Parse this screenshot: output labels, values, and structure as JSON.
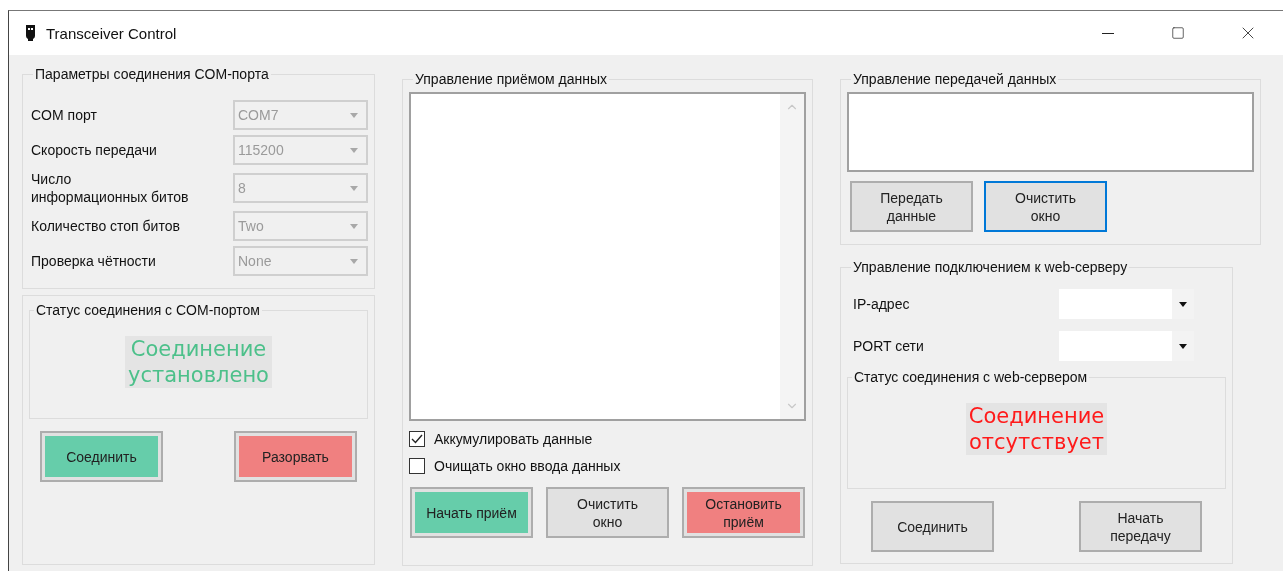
{
  "window": {
    "title": "Transceiver Control"
  },
  "com_params": {
    "title": "Параметры соединения COM-порта",
    "fields": [
      {
        "label": "COM порт",
        "value": "COM7",
        "disabled": true
      },
      {
        "label": "Скорость передачи",
        "value": "115200",
        "disabled": true
      },
      {
        "label": "Число\nинформационных битов",
        "value": "8",
        "disabled": true
      },
      {
        "label": "Количество стоп битов",
        "value": "Two",
        "disabled": true
      },
      {
        "label": "Проверка чётности",
        "value": "None",
        "disabled": true
      }
    ]
  },
  "com_status": {
    "title": "Статус соединения с COM-портом",
    "status": {
      "text": "Соединение\nустановлено",
      "color": "#4cc08a"
    },
    "buttons": [
      {
        "label": "Соединить",
        "color": "#66cdaa",
        "focused": false
      },
      {
        "label": "Разорвать",
        "color": "#f08080",
        "focused": false
      }
    ]
  },
  "receive": {
    "title": "Управление приёмом данных",
    "options": [
      {
        "label": "Аккумулировать данные",
        "checked": true
      },
      {
        "label": "Очищать окно ввода данных",
        "checked": false
      }
    ],
    "buttons": [
      {
        "label": "Начать приём",
        "color": "#66cdaa",
        "focused": false
      },
      {
        "label": "Очистить\nокно",
        "color": "#e1e1e1",
        "focused": false
      },
      {
        "label": "Остановить\nприём",
        "color": "#f08080",
        "focused": false
      }
    ]
  },
  "transmit": {
    "title": "Управление передачей данных",
    "buttons": [
      {
        "label": "Передать\nданные",
        "color": "#e1e1e1",
        "focused": false
      },
      {
        "label": "Очистить\nокно",
        "color": "#e1e1e1",
        "focused": true
      }
    ]
  },
  "web": {
    "title": "Управление подключением к web-серверу",
    "fields": [
      {
        "label": "IP-адрес",
        "disabled": false
      },
      {
        "label": "PORT сети",
        "disabled": false
      }
    ],
    "status_title": "Статус соединения с web-сервером",
    "status": {
      "text": "Соединение\nотсутствует",
      "color": "#ff1a1a"
    },
    "buttons": [
      {
        "label": "Соединить",
        "color": "#e1e1e1",
        "focused": false
      },
      {
        "label": "Начать\nпередачу",
        "color": "#e1e1e1",
        "focused": false
      }
    ]
  }
}
